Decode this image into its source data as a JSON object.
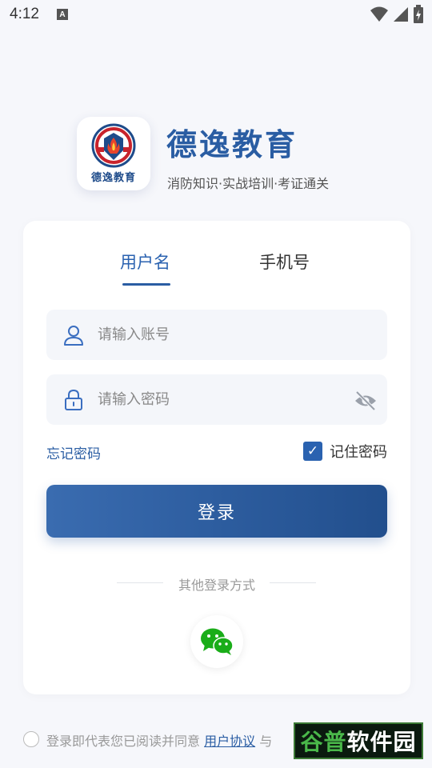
{
  "status_bar": {
    "time": "4:12",
    "notification_badge": "A",
    "icons": [
      "wifi-icon",
      "signal-icon",
      "battery-icon"
    ]
  },
  "brand": {
    "logo_caption": "德逸教育",
    "title": "德逸教育",
    "subtitle": "消防知识·实战培训·考证通关"
  },
  "login": {
    "tabs": [
      {
        "label": "用户名",
        "active": true
      },
      {
        "label": "手机号",
        "active": false
      }
    ],
    "account_placeholder": "请输入账号",
    "password_placeholder": "请输入密码",
    "forgot_label": "忘记密码",
    "remember_label": "记住密码",
    "remember_checked": true,
    "remember_check_glyph": "✓",
    "submit_label": "登录",
    "other_methods_label": "其他登录方式",
    "other_methods": [
      "wechat-icon"
    ]
  },
  "agreement": {
    "prefix": "登录即代表您已阅读并同意 ",
    "user_agreement": "用户协议",
    "conjunction": " 与 "
  },
  "watermark": {
    "part1": "谷普",
    "part2": "软件园"
  },
  "colors": {
    "primary": "#2a5da3",
    "wechat": "#1aad19",
    "page_bg": "#f6f7fb",
    "input_bg": "#f4f6fa"
  }
}
